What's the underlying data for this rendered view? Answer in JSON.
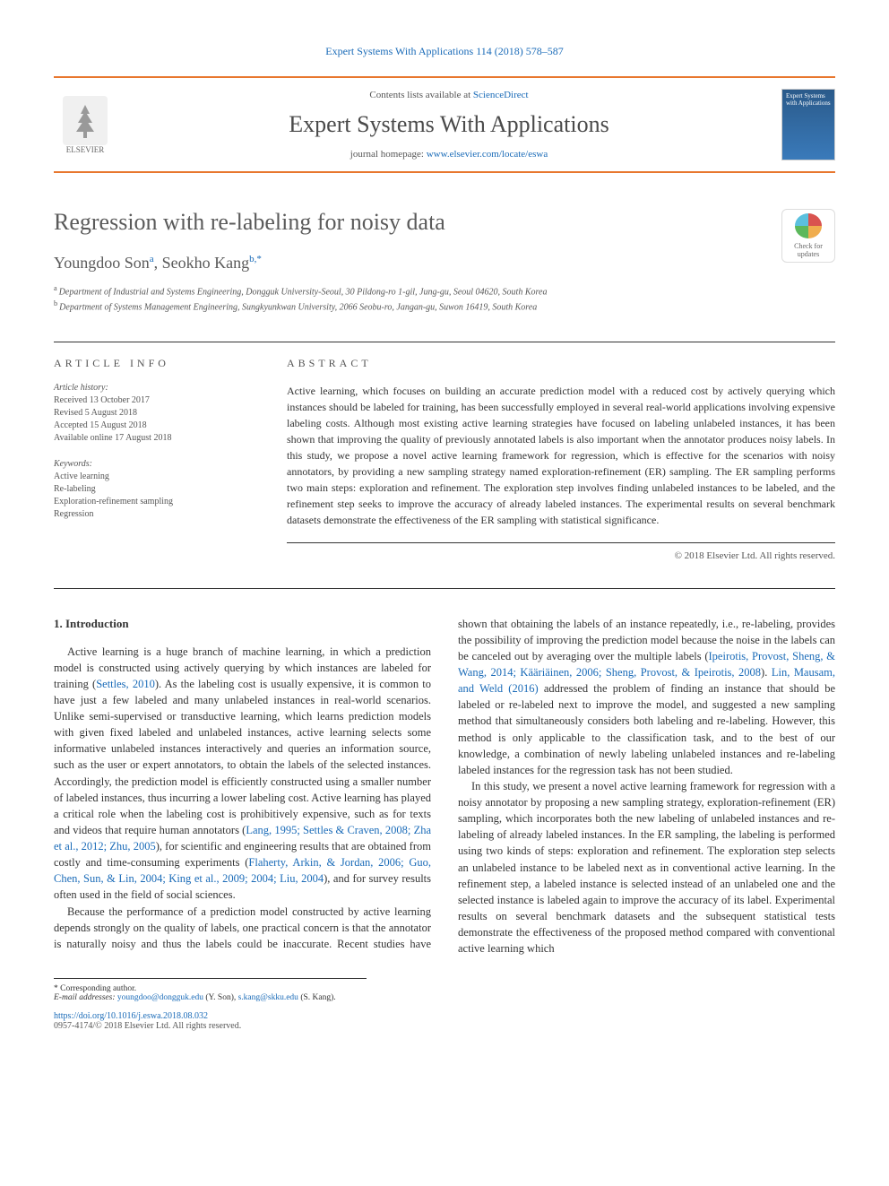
{
  "header_link": "Expert Systems With Applications 114 (2018) 578–587",
  "banner": {
    "contents_prefix": "Contents lists available at ",
    "contents_link": "ScienceDirect",
    "journal_name": "Expert Systems With Applications",
    "homepage_prefix": "journal homepage: ",
    "homepage_url": "www.elsevier.com/locate/eswa",
    "publisher_logo": "ELSEVIER",
    "cover_text": "Expert Systems with Applications"
  },
  "check_updates": "Check for updates",
  "title": "Regression with re-labeling for noisy data",
  "authors_html": "Youngdoo Son",
  "author1": "Youngdoo Son",
  "aff1_sup": "a",
  "author_sep": ", ",
  "author2": "Seokho Kang",
  "aff2_sup": "b,",
  "corr_sup": "*",
  "affiliations": {
    "a": "Department of Industrial and Systems Engineering, Dongguk University-Seoul, 30 Pildong-ro 1-gil, Jung-gu, Seoul 04620, South Korea",
    "b": "Department of Systems Management Engineering, Sungkyunkwan University, 2066 Seobu-ro, Jangan-gu, Suwon 16419, South Korea"
  },
  "info": {
    "heading": "ARTICLE INFO",
    "history_label": "Article history:",
    "received": "Received 13 October 2017",
    "revised": "Revised 5 August 2018",
    "accepted": "Accepted 15 August 2018",
    "available": "Available online 17 August 2018",
    "keywords_label": "Keywords:",
    "keywords": [
      "Active learning",
      "Re-labeling",
      "Exploration-refinement sampling",
      "Regression"
    ]
  },
  "abstract": {
    "heading": "ABSTRACT",
    "text": "Active learning, which focuses on building an accurate prediction model with a reduced cost by actively querying which instances should be labeled for training, has been successfully employed in several real-world applications involving expensive labeling costs. Although most existing active learning strategies have focused on labeling unlabeled instances, it has been shown that improving the quality of previously annotated labels is also important when the annotator produces noisy labels. In this study, we propose a novel active learning framework for regression, which is effective for the scenarios with noisy annotators, by providing a new sampling strategy named exploration-refinement (ER) sampling. The ER sampling performs two main steps: exploration and refinement. The exploration step involves finding unlabeled instances to be labeled, and the refinement step seeks to improve the accuracy of already labeled instances. The experimental results on several benchmark datasets demonstrate the effectiveness of the ER sampling with statistical significance.",
    "copyright": "© 2018 Elsevier Ltd. All rights reserved."
  },
  "section1_title": "1. Introduction",
  "para1_a": "Active learning is a huge branch of machine learning, in which a prediction model is constructed using actively querying by which instances are labeled for training (",
  "ref_settles2010": "Settles, 2010",
  "para1_b": "). As the labeling cost is usually expensive, it is common to have just a few labeled and many unlabeled instances in real-world scenarios. Unlike semi-supervised or transductive learning, which learns prediction models with given fixed labeled and unlabeled instances, active learning selects some informative unlabeled instances interactively and queries an information source, such as the user or expert annotators, to obtain the labels of the selected instances. Accordingly, the prediction model is efficiently constructed using a smaller number of labeled instances, thus incurring a lower labeling cost. Active learning has played a critical role when the labeling cost is prohibitively expensive, such as for texts and videos that require human annotators (",
  "ref_lang1995": "Lang, 1995; Settles & Craven, 2008; Zha et al., 2012; Zhu, 2005",
  "para1_c": "), for scientific and engineering results that are obtained from costly and time-consuming experiments (",
  "ref_flaherty": "Flaherty, Arkin, & Jordan, 2006; Guo, Chen, Sun, & Lin, 2004; King et al., 2009; 2004; Liu, 2004",
  "para1_d": "), and for survey results often used in the field of social sciences.",
  "para2_a": "Because the performance of a prediction model constructed by active learning depends strongly on the quality of labels, one prac",
  "para2_b": "tical concern is that the annotator is naturally noisy and thus the labels could be inaccurate. Recent studies have shown that obtaining the labels of an instance repeatedly, i.e., re-labeling, provides the possibility of improving the prediction model because the noise in the labels can be canceled out by averaging over the multiple labels (",
  "ref_ipeirotis": "Ipeirotis, Provost, Sheng, & Wang, 2014; Kääriäinen, 2006; Sheng, Provost, & Ipeirotis, 2008",
  "para2_c": "). ",
  "ref_lin2016": "Lin, Mausam, and Weld (2016)",
  "para2_d": " addressed the problem of finding an instance that should be labeled or re-labeled next to improve the model, and suggested a new sampling method that simultaneously considers both labeling and re-labeling. However, this method is only applicable to the classification task, and to the best of our knowledge, a combination of newly labeling unlabeled instances and re-labeling labeled instances for the regression task has not been studied.",
  "para3": "In this study, we present a novel active learning framework for regression with a noisy annotator by proposing a new sampling strategy, exploration-refinement (ER) sampling, which incorporates both the new labeling of unlabeled instances and re-labeling of already labeled instances. In the ER sampling, the labeling is performed using two kinds of steps: exploration and refinement. The exploration step selects an unlabeled instance to be labeled next as in conventional active learning. In the refinement step, a labeled instance is selected instead of an unlabeled one and the selected instance is labeled again to improve the accuracy of its label. Experimental results on several benchmark datasets and the subsequent statistical tests demonstrate the effectiveness of the proposed method compared with conventional active learning which",
  "footnote": {
    "corr": "* Corresponding author.",
    "email_label": "E-mail addresses: ",
    "email1": "youngdoo@dongguk.edu",
    "email1_name": " (Y. Son), ",
    "email2": "s.kang@skku.edu",
    "email2_name": " (S. Kang)."
  },
  "footer": {
    "doi": "https://doi.org/10.1016/j.eswa.2018.08.032",
    "issn_line": "0957-4174/© 2018 Elsevier Ltd. All rights reserved."
  }
}
